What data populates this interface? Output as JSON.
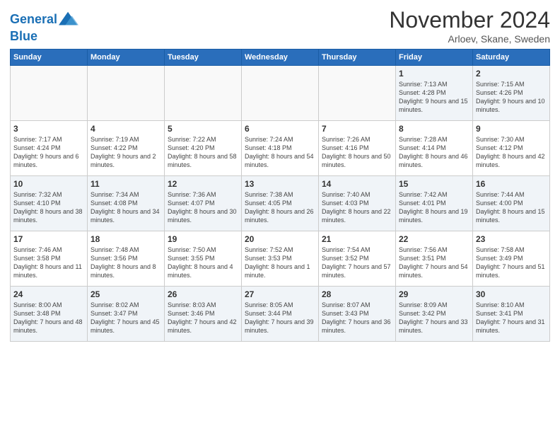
{
  "header": {
    "logo_line1": "General",
    "logo_line2": "Blue",
    "month_title": "November 2024",
    "subtitle": "Arloev, Skane, Sweden"
  },
  "days_of_week": [
    "Sunday",
    "Monday",
    "Tuesday",
    "Wednesday",
    "Thursday",
    "Friday",
    "Saturday"
  ],
  "weeks": [
    [
      {
        "day": "",
        "info": ""
      },
      {
        "day": "",
        "info": ""
      },
      {
        "day": "",
        "info": ""
      },
      {
        "day": "",
        "info": ""
      },
      {
        "day": "",
        "info": ""
      },
      {
        "day": "1",
        "info": "Sunrise: 7:13 AM\nSunset: 4:28 PM\nDaylight: 9 hours and 15 minutes."
      },
      {
        "day": "2",
        "info": "Sunrise: 7:15 AM\nSunset: 4:26 PM\nDaylight: 9 hours and 10 minutes."
      }
    ],
    [
      {
        "day": "3",
        "info": "Sunrise: 7:17 AM\nSunset: 4:24 PM\nDaylight: 9 hours and 6 minutes."
      },
      {
        "day": "4",
        "info": "Sunrise: 7:19 AM\nSunset: 4:22 PM\nDaylight: 9 hours and 2 minutes."
      },
      {
        "day": "5",
        "info": "Sunrise: 7:22 AM\nSunset: 4:20 PM\nDaylight: 8 hours and 58 minutes."
      },
      {
        "day": "6",
        "info": "Sunrise: 7:24 AM\nSunset: 4:18 PM\nDaylight: 8 hours and 54 minutes."
      },
      {
        "day": "7",
        "info": "Sunrise: 7:26 AM\nSunset: 4:16 PM\nDaylight: 8 hours and 50 minutes."
      },
      {
        "day": "8",
        "info": "Sunrise: 7:28 AM\nSunset: 4:14 PM\nDaylight: 8 hours and 46 minutes."
      },
      {
        "day": "9",
        "info": "Sunrise: 7:30 AM\nSunset: 4:12 PM\nDaylight: 8 hours and 42 minutes."
      }
    ],
    [
      {
        "day": "10",
        "info": "Sunrise: 7:32 AM\nSunset: 4:10 PM\nDaylight: 8 hours and 38 minutes."
      },
      {
        "day": "11",
        "info": "Sunrise: 7:34 AM\nSunset: 4:08 PM\nDaylight: 8 hours and 34 minutes."
      },
      {
        "day": "12",
        "info": "Sunrise: 7:36 AM\nSunset: 4:07 PM\nDaylight: 8 hours and 30 minutes."
      },
      {
        "day": "13",
        "info": "Sunrise: 7:38 AM\nSunset: 4:05 PM\nDaylight: 8 hours and 26 minutes."
      },
      {
        "day": "14",
        "info": "Sunrise: 7:40 AM\nSunset: 4:03 PM\nDaylight: 8 hours and 22 minutes."
      },
      {
        "day": "15",
        "info": "Sunrise: 7:42 AM\nSunset: 4:01 PM\nDaylight: 8 hours and 19 minutes."
      },
      {
        "day": "16",
        "info": "Sunrise: 7:44 AM\nSunset: 4:00 PM\nDaylight: 8 hours and 15 minutes."
      }
    ],
    [
      {
        "day": "17",
        "info": "Sunrise: 7:46 AM\nSunset: 3:58 PM\nDaylight: 8 hours and 11 minutes."
      },
      {
        "day": "18",
        "info": "Sunrise: 7:48 AM\nSunset: 3:56 PM\nDaylight: 8 hours and 8 minutes."
      },
      {
        "day": "19",
        "info": "Sunrise: 7:50 AM\nSunset: 3:55 PM\nDaylight: 8 hours and 4 minutes."
      },
      {
        "day": "20",
        "info": "Sunrise: 7:52 AM\nSunset: 3:53 PM\nDaylight: 8 hours and 1 minute."
      },
      {
        "day": "21",
        "info": "Sunrise: 7:54 AM\nSunset: 3:52 PM\nDaylight: 7 hours and 57 minutes."
      },
      {
        "day": "22",
        "info": "Sunrise: 7:56 AM\nSunset: 3:51 PM\nDaylight: 7 hours and 54 minutes."
      },
      {
        "day": "23",
        "info": "Sunrise: 7:58 AM\nSunset: 3:49 PM\nDaylight: 7 hours and 51 minutes."
      }
    ],
    [
      {
        "day": "24",
        "info": "Sunrise: 8:00 AM\nSunset: 3:48 PM\nDaylight: 7 hours and 48 minutes."
      },
      {
        "day": "25",
        "info": "Sunrise: 8:02 AM\nSunset: 3:47 PM\nDaylight: 7 hours and 45 minutes."
      },
      {
        "day": "26",
        "info": "Sunrise: 8:03 AM\nSunset: 3:46 PM\nDaylight: 7 hours and 42 minutes."
      },
      {
        "day": "27",
        "info": "Sunrise: 8:05 AM\nSunset: 3:44 PM\nDaylight: 7 hours and 39 minutes."
      },
      {
        "day": "28",
        "info": "Sunrise: 8:07 AM\nSunset: 3:43 PM\nDaylight: 7 hours and 36 minutes."
      },
      {
        "day": "29",
        "info": "Sunrise: 8:09 AM\nSunset: 3:42 PM\nDaylight: 7 hours and 33 minutes."
      },
      {
        "day": "30",
        "info": "Sunrise: 8:10 AM\nSunset: 3:41 PM\nDaylight: 7 hours and 31 minutes."
      }
    ]
  ]
}
